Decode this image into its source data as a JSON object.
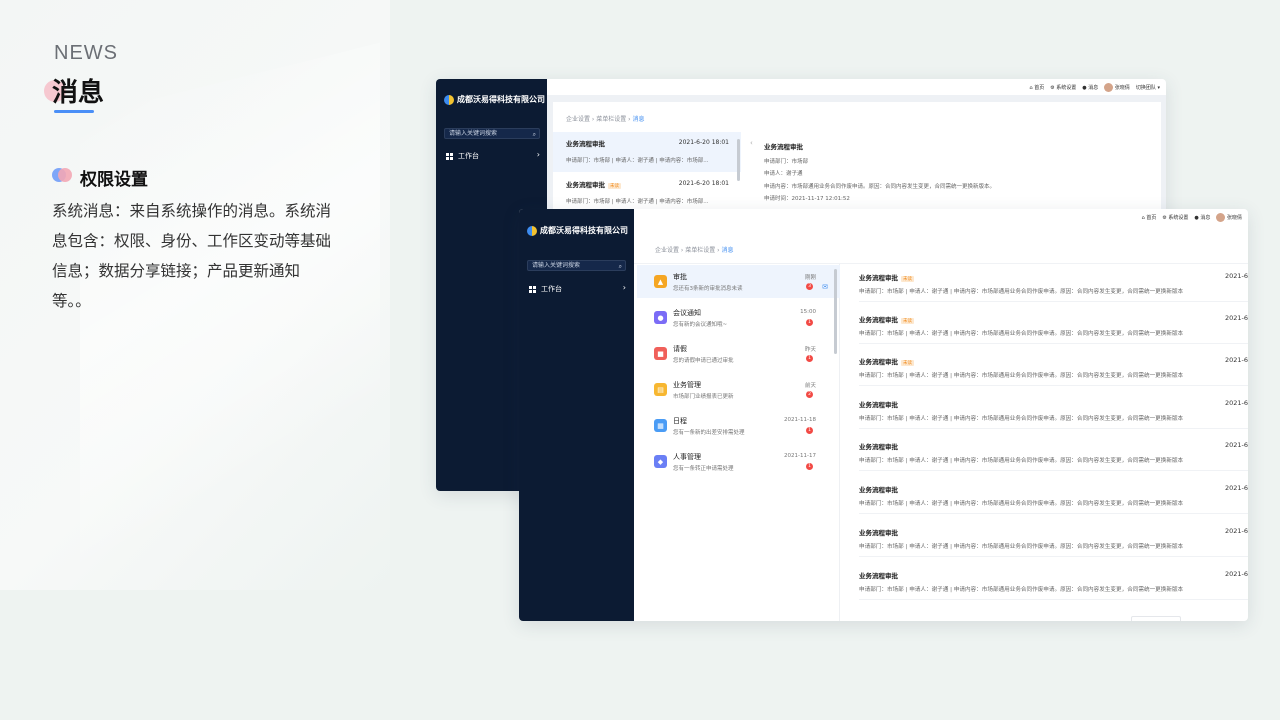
{
  "intro": {
    "news": "NEWS",
    "title": "消息",
    "section_title": "权限设置",
    "description": "系统消息：来自系统操作的消息。系统消息包含：权限、身份、工作区变动等基础信息；数据分享链接；产品更新通知等。。"
  },
  "colors": {
    "sidebar": "#0c1b33",
    "accent": "#3d8cf0",
    "badge": "#f24a45",
    "tag": "#f08a1c"
  },
  "winA": {
    "brand": "成都沃易得科技有限公司",
    "search_placeholder": "请输入关键词搜索",
    "nav_label": "工作台",
    "topbar": {
      "home": "首页",
      "settings": "系统设置",
      "messages": "消息",
      "user": "张晓倩",
      "switch": "切换团队"
    },
    "breadcrumb": [
      "企业设置",
      "菜单栏设置",
      "消息"
    ],
    "list": [
      {
        "title": "业务流程审批",
        "time": "2021-6-20 18:01",
        "sub": "申请部门：市场部 | 申请人：谢子通 | 申请内容：市场部...",
        "tag": ""
      },
      {
        "title": "业务流程审批",
        "time": "2021-6-20 18:01",
        "sub": "申请部门：市场部 | 申请人：谢子通 | 申请内容：市场部...",
        "tag": "未读"
      }
    ],
    "detail": {
      "title": "业务流程审批",
      "lines": [
        "申请部门：市场部",
        "申请人：谢子通",
        "申请内容：市场部通用业务合同作废申请。原因：合同内容发生变更，合同需统一更换新版本。",
        "申请时间：2021-11-17 12:01:52"
      ]
    }
  },
  "winB": {
    "brand": "成都沃易得科技有限公司",
    "search_placeholder": "请输入关键词搜索",
    "nav_label": "工作台",
    "topbar": {
      "home": "首页",
      "settings": "系统设置",
      "messages": "消息",
      "user": "张晓倩"
    },
    "breadcrumb": [
      "企业设置",
      "菜单栏设置",
      "消息"
    ],
    "categories": [
      {
        "title": "审批",
        "sub": "您还有3条新的审批消息未读",
        "time": "刚刚",
        "badge": "3",
        "icon": "approval-icon",
        "color": "#f5a623"
      },
      {
        "title": "会议通知",
        "sub": "您有新的会议通知哦~",
        "time": "15:00",
        "badge": "1",
        "icon": "meeting-icon",
        "color": "#7b6cf6"
      },
      {
        "title": "请假",
        "sub": "您的请假申请已通过审批",
        "time": "昨天",
        "badge": "1",
        "icon": "leave-icon",
        "color": "#f0605a"
      },
      {
        "title": "业务管理",
        "sub": "市场部门业绩报表已更新",
        "time": "前天",
        "badge": "2",
        "icon": "business-icon",
        "color": "#f7b731"
      },
      {
        "title": "日程",
        "sub": "您有一条新的出差安排需处理",
        "time": "2021-11-18",
        "badge": "1",
        "icon": "calendar-icon",
        "color": "#4a9cf5"
      },
      {
        "title": "人事管理",
        "sub": "您有一条转正申请需处理",
        "time": "2021-11-17",
        "badge": "1",
        "icon": "hr-icon",
        "color": "#6a7ff5"
      }
    ],
    "messages": [
      {
        "title": "业务流程审批",
        "tag": "未读",
        "date": "2021-6",
        "sub": "申请部门：市场部 | 申请人：谢子通 | 申请内容：市场部通用业务合同作废申请。原因：合同内容发生变更，合同需统一更换新版本"
      },
      {
        "title": "业务流程审批",
        "tag": "未读",
        "date": "2021-6",
        "sub": "申请部门：市场部 | 申请人：谢子通 | 申请内容：市场部通用业务合同作废申请。原因：合同内容发生变更，合同需统一更换新版本"
      },
      {
        "title": "业务流程审批",
        "tag": "未读",
        "date": "2021-6",
        "sub": "申请部门：市场部 | 申请人：谢子通 | 申请内容：市场部通用业务合同作废申请。原因：合同内容发生变更，合同需统一更换新版本"
      },
      {
        "title": "业务流程审批",
        "tag": "",
        "date": "2021-6",
        "sub": "申请部门：市场部 | 申请人：谢子通 | 申请内容：市场部通用业务合同作废申请。原因：合同内容发生变更，合同需统一更换新版本"
      },
      {
        "title": "业务流程审批",
        "tag": "",
        "date": "2021-6",
        "sub": "申请部门：市场部 | 申请人：谢子通 | 申请内容：市场部通用业务合同作废申请。原因：合同内容发生变更，合同需统一更换新版本"
      },
      {
        "title": "业务流程审批",
        "tag": "",
        "date": "2021-6",
        "sub": "申请部门：市场部 | 申请人：谢子通 | 申请内容：市场部通用业务合同作废申请。原因：合同内容发生变更，合同需统一更换新版本"
      },
      {
        "title": "业务流程审批",
        "tag": "",
        "date": "2021-6",
        "sub": "申请部门：市场部 | 申请人：谢子通 | 申请内容：市场部通用业务合同作废申请。原因：合同内容发生变更，合同需统一更换新版本"
      },
      {
        "title": "业务流程审批",
        "tag": "",
        "date": "2021-6",
        "sub": "申请部门：市场部 | 申请人：谢子通 | 申请内容：市场部通用业务合同作废申请。原因：合同内容发生变更，合同需统一更换新版本"
      }
    ]
  }
}
